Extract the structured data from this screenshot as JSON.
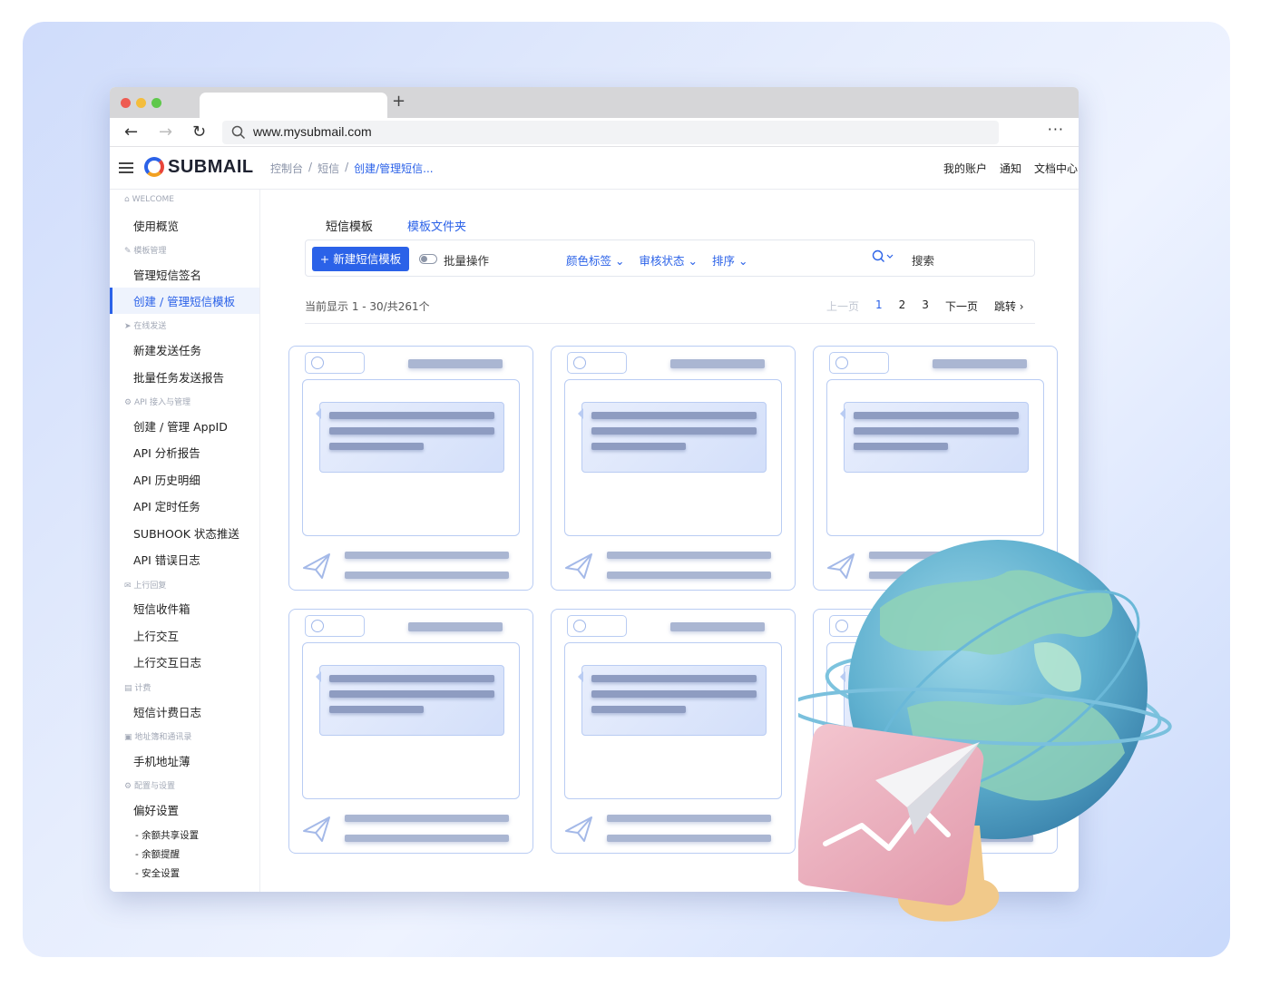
{
  "browser": {
    "new_tab": "+",
    "back_icon": "←",
    "forward_icon": "→",
    "reload_icon": "↻",
    "search_icon": "🔍",
    "url": "www.mysubmail.com",
    "more": "···"
  },
  "header": {
    "brand": "SUBMAIL",
    "breadcrumbs": [
      "控制台",
      "/",
      "短信",
      "/",
      "创建/管理短信..."
    ],
    "nav": [
      "我的账户",
      "通知",
      "文档中心"
    ]
  },
  "sidebar": {
    "sections": [
      {
        "title": "WELCOME",
        "items": [
          "使用概览"
        ]
      },
      {
        "title": "模板管理",
        "items": [
          "管理短信签名",
          "创建 / 管理短信模板"
        ]
      },
      {
        "title": "在线发送",
        "items": [
          "新建发送任务",
          "批量任务发送报告"
        ]
      },
      {
        "title": "API 接入与管理",
        "items": [
          "创建 / 管理 AppID",
          "API 分析报告",
          "API 历史明细",
          "API 定时任务",
          "SUBHOOK 状态推送",
          "API 错误日志"
        ]
      },
      {
        "title": "上行回复",
        "items": [
          "短信收件箱",
          "上行交互",
          "上行交互日志"
        ]
      },
      {
        "title": "计费",
        "items": [
          "短信计费日志"
        ]
      },
      {
        "title": "地址簿和通讯录",
        "items": [
          "手机地址薄"
        ]
      },
      {
        "title": "配置与设置",
        "items": [
          "偏好设置"
        ]
      }
    ],
    "sub_items": [
      "- 余额共享设置",
      "- 余额提醒",
      "- 安全设置"
    ],
    "active": "创建 / 管理短信模板"
  },
  "main": {
    "tabs": [
      "短信模板",
      "模板文件夹"
    ],
    "new_button": "+ 新建短信模板",
    "batch_label": "批量操作",
    "filters": [
      "颜色标签",
      "审核状态",
      "排序"
    ],
    "search_label": "搜索",
    "count_text": "当前显示 1 - 30/共261个",
    "pager": {
      "prev": "上一页",
      "pages": [
        "1",
        "2",
        "3"
      ],
      "next": "下一页",
      "jump": "跳转"
    },
    "chevron": "⌄"
  },
  "colors": {
    "accent": "#2b62e8",
    "card_border": "#b9ccf3",
    "placeholder_bar": "#8e9cc1"
  }
}
